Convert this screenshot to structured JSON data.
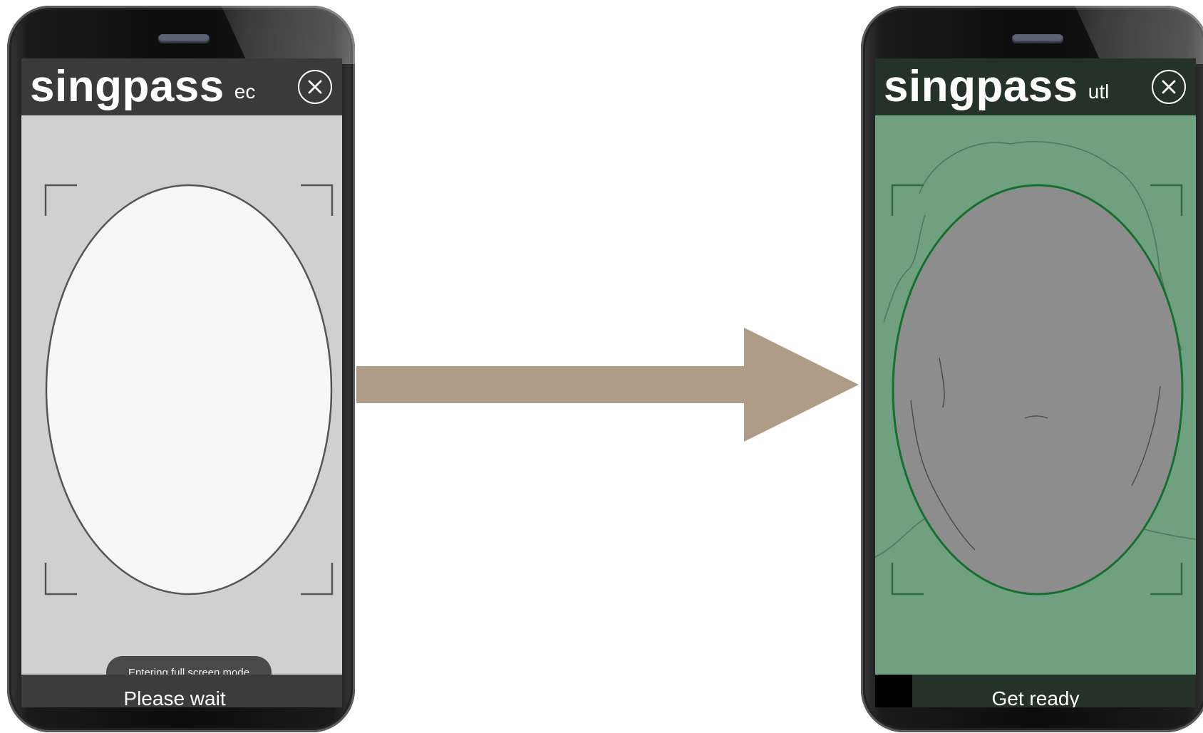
{
  "left_screen": {
    "brand": "singpass",
    "brand_suffix": "ec",
    "toast": "Entering full screen mode",
    "status": "Please wait",
    "close_icon": "close-icon",
    "camera_bg": "#d0d0d0",
    "oval_fill": "#f7f7f7"
  },
  "right_screen": {
    "brand": "singpass",
    "brand_suffix": "utl",
    "status": "Get ready",
    "close_icon": "close-icon",
    "camera_bg": "#71a081",
    "oval_outline": "#13702e"
  },
  "arrow": {
    "color": "#ad9d86",
    "icon": "right-arrow-icon"
  }
}
